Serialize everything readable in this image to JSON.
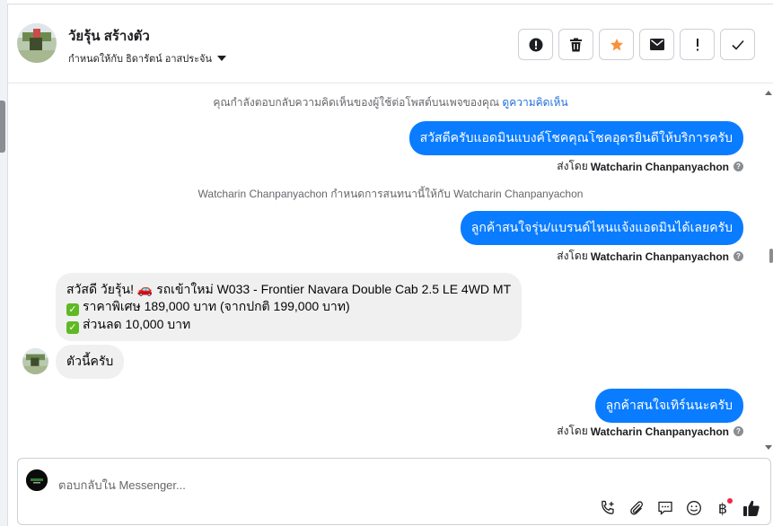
{
  "header": {
    "contact_name": "วัยรุ้น สร้างตัว",
    "assigned_to": "กำหนดให้กับ ธิดารัตน์ อาสประจัน"
  },
  "actions": [
    {
      "name": "spam-report-button",
      "icon": "exclamation-circle-icon"
    },
    {
      "name": "delete-button",
      "icon": "trash-icon"
    },
    {
      "name": "star-button",
      "icon": "star-icon"
    },
    {
      "name": "mark-unread-button",
      "icon": "envelope-icon"
    },
    {
      "name": "follow-up-button",
      "icon": "exclamation-icon"
    },
    {
      "name": "done-button",
      "icon": "check-icon"
    }
  ],
  "chat": {
    "context_text": "คุณกำลังตอบกลับความคิดเห็นของผู้ใช้ต่อโพสต์บนเพจของคุณ",
    "context_link": "ดูความคิดเห็น",
    "msg1": "สวัสดีครับแอดมินแบงค์โชคคุณโชคอุดรยินดีให้บริการครับ",
    "sent_by_prefix": "ส่งโดย",
    "sender": "Watcharin Chanpanyachon",
    "assign_event": "Watcharin Chanpanyachon กำหนดการสนทนานี้ให้กับ Watcharin Chanpanyachon",
    "msg2": "ลูกค้าสนใจรุ่น/แบรนด์ไหนแจ้งแอดมินได้เลยครับ",
    "incoming1": {
      "line1": "สวัสดี วัยรุ้น! 🚗 รถเข้าใหม่ W033 - Frontier Navara Double Cab 2.5 LE 4WD MT",
      "line2": "ราคาพิเศษ 189,000 บาท (จากปกติ 199,000 บาท)",
      "line3": "ส่วนลด 10,000 บาท"
    },
    "incoming2": "ตัวนี้ครับ",
    "msg3": "ลูกค้าสนใจเทิร์นนะครับ"
  },
  "composer": {
    "placeholder": "ตอบกลับใน Messenger...",
    "tools": [
      "phone-plus-icon",
      "paperclip-icon",
      "chat-bubble-icon",
      "smiley-icon",
      "baht-icon",
      "thumbs-up-icon"
    ]
  },
  "colors": {
    "outgoing_bubble": "#0a7cff",
    "incoming_bubble": "#f0f0f0",
    "star": "#f7923b",
    "link": "#216fdb"
  }
}
